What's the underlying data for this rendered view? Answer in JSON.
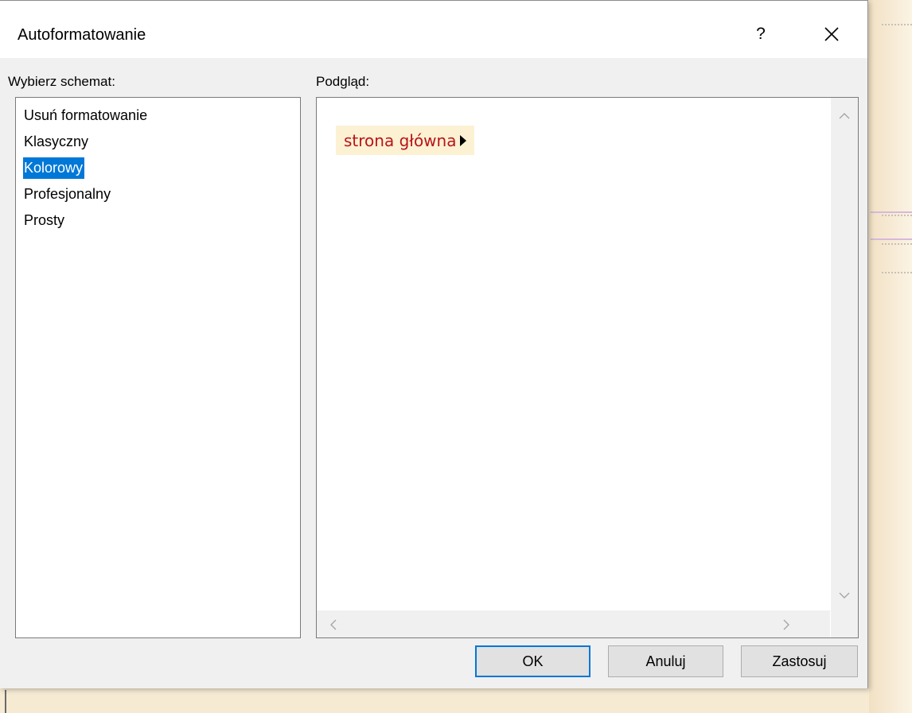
{
  "dialog": {
    "title": "Autoformatowanie",
    "help_label": "?",
    "scheme_label": "Wybierz schemat:",
    "preview_label": "Podgląd:",
    "schemes": [
      {
        "label": "Usuń formatowanie",
        "selected": false
      },
      {
        "label": "Klasyczny",
        "selected": false
      },
      {
        "label": "Kolorowy",
        "selected": true
      },
      {
        "label": "Profesjonalny",
        "selected": false
      },
      {
        "label": "Prosty",
        "selected": false
      }
    ],
    "preview": {
      "path_node": "strona główna"
    },
    "buttons": {
      "ok": "OK",
      "cancel": "Anuluj",
      "apply": "Zastosuj"
    }
  },
  "colors": {
    "selection": "#0078d7",
    "preview_node_text": "#b7141b",
    "preview_node_background": "#fdf1d3"
  },
  "icons": {
    "close": "close-icon",
    "scroll_up": "chevron-up-icon",
    "scroll_down": "chevron-down-icon",
    "scroll_left": "chevron-left-icon",
    "scroll_right": "chevron-right-icon",
    "node_arrow": "triangle-right-icon"
  }
}
